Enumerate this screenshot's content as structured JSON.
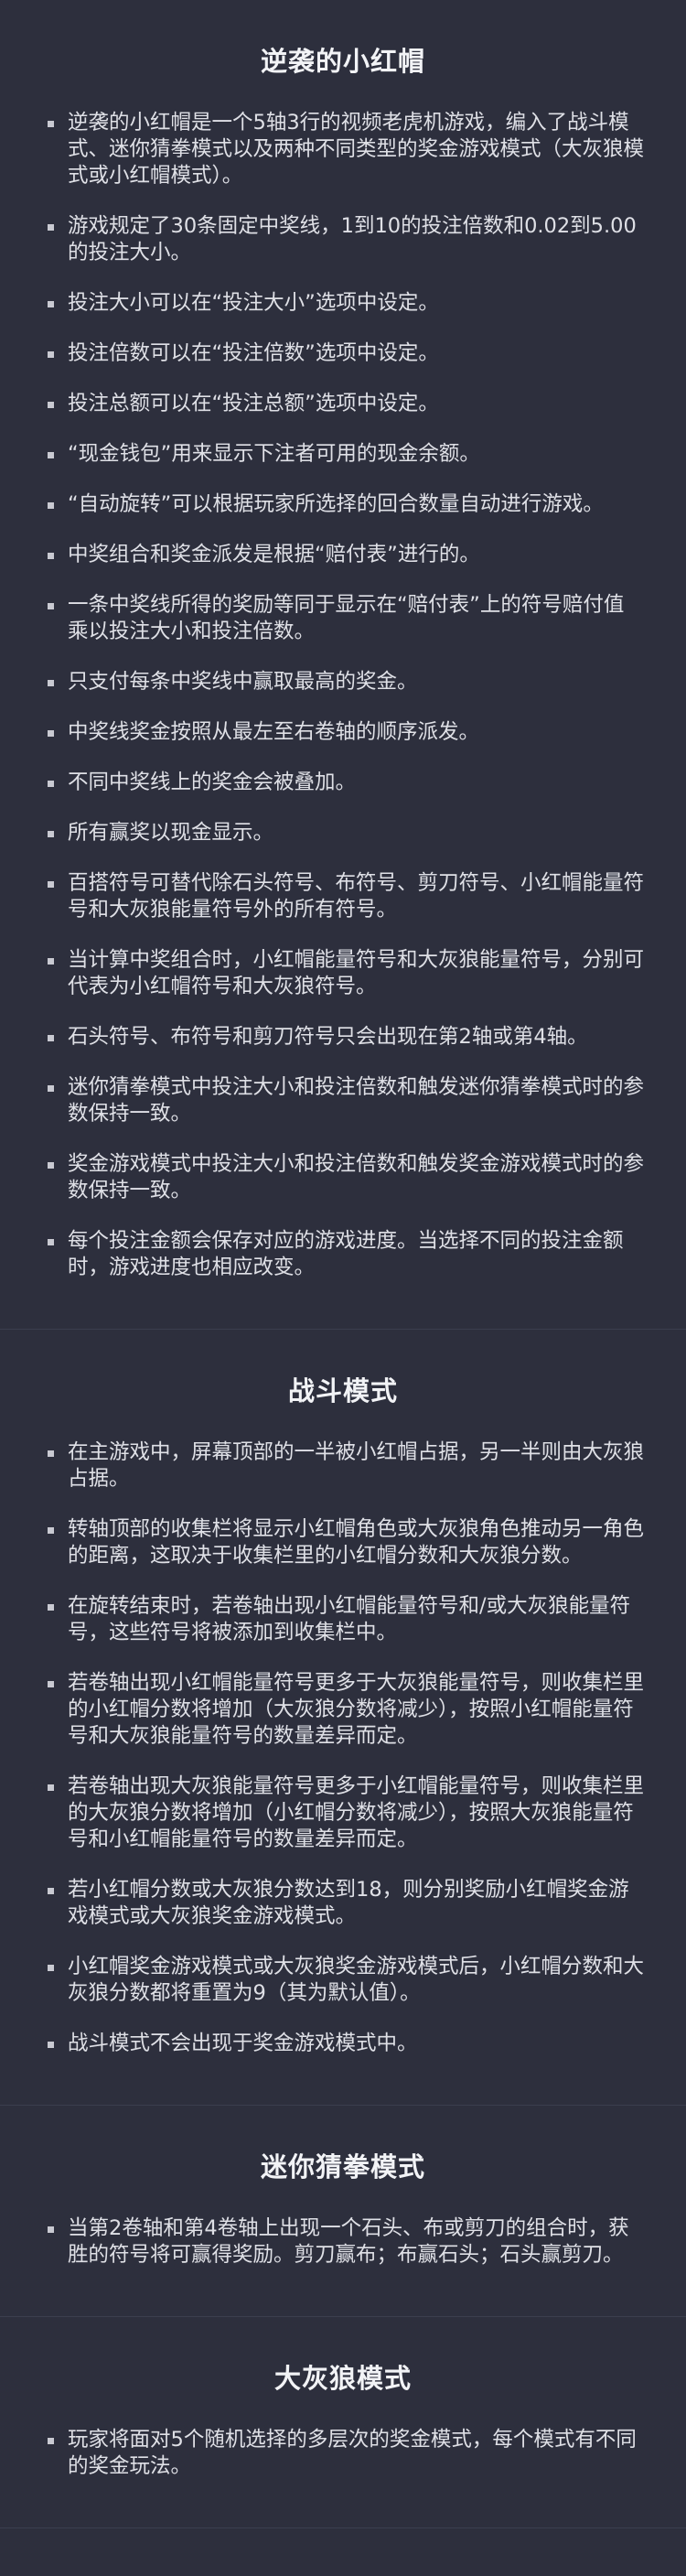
{
  "sections": [
    {
      "title": "逆袭的小红帽",
      "items": [
        "逆袭的小红帽是一个5轴3行的视频老虎机游戏，编入了战斗模式、迷你猜拳模式以及两种不同类型的奖金游戏模式（大灰狼模式或小红帽模式）。",
        "游戏规定了30条固定中奖线，1到10的投注倍数和0.02到5.00的投注大小。",
        "投注大小可以在“投注大小”选项中设定。",
        "投注倍数可以在“投注倍数”选项中设定。",
        "投注总额可以在“投注总额”选项中设定。",
        "“现金钱包”用来显示下注者可用的现金余额。",
        "“自动旋转”可以根据玩家所选择的回合数量自动进行游戏。",
        "中奖组合和奖金派发是根据“赔付表”进行的。",
        "一条中奖线所得的奖励等同于显示在“赔付表”上的符号赔付值乘以投注大小和投注倍数。",
        "只支付每条中奖线中赢取最高的奖金。",
        "中奖线奖金按照从最左至右卷轴的顺序派发。",
        "不同中奖线上的奖金会被叠加。",
        "所有赢奖以现金显示。",
        "百搭符号可替代除石头符号、布符号、剪刀符号、小红帽能量符号和大灰狼能量符号外的所有符号。",
        "当计算中奖组合时，小红帽能量符号和大灰狼能量符号，分别可代表为小红帽符号和大灰狼符号。",
        "石头符号、布符号和剪刀符号只会出现在第2轴或第4轴。",
        "迷你猜拳模式中投注大小和投注倍数和触发迷你猜拳模式时的参数保持一致。",
        "奖金游戏模式中投注大小和投注倍数和触发奖金游戏模式时的参数保持一致。",
        "每个投注金额会保存对应的游戏进度。当选择不同的投注金额时，游戏进度也相应改变。"
      ]
    },
    {
      "title": "战斗模式",
      "items": [
        "在主游戏中，屏幕顶部的一半被小红帽占据，另一半则由大灰狼占据。",
        "转轴顶部的收集栏将显示小红帽角色或大灰狼角色推动另一角色的距离，这取决于收集栏里的小红帽分数和大灰狼分数。",
        "在旋转结束时，若卷轴出现小红帽能量符号和/或大灰狼能量符号，这些符号将被添加到收集栏中。",
        "若卷轴出现小红帽能量符号更多于大灰狼能量符号，则收集栏里的小红帽分数将增加（大灰狼分数将减少），按照小红帽能量符号和大灰狼能量符号的数量差异而定。",
        "若卷轴出现大灰狼能量符号更多于小红帽能量符号，则收集栏里的大灰狼分数将增加（小红帽分数将减少），按照大灰狼能量符号和小红帽能量符号的数量差异而定。",
        "若小红帽分数或大灰狼分数达到18，则分别奖励小红帽奖金游戏模式或大灰狼奖金游戏模式。",
        "小红帽奖金游戏模式或大灰狼奖金游戏模式后，小红帽分数和大灰狼分数都将重置为9（其为默认值）。",
        "战斗模式不会出现于奖金游戏模式中。"
      ]
    },
    {
      "title": "迷你猜拳模式",
      "items": [
        "当第2卷轴和第4卷轴上出现一个石头、布或剪刀的组合时，获胜的符号将可赢得奖励。剪刀赢布；布赢石头；石头赢剪刀。"
      ]
    },
    {
      "title": "大灰狼模式",
      "items": [
        "玩家将面对5个随机选择的多层次的奖金模式，每个模式有不同的奖金玩法。"
      ]
    }
  ]
}
